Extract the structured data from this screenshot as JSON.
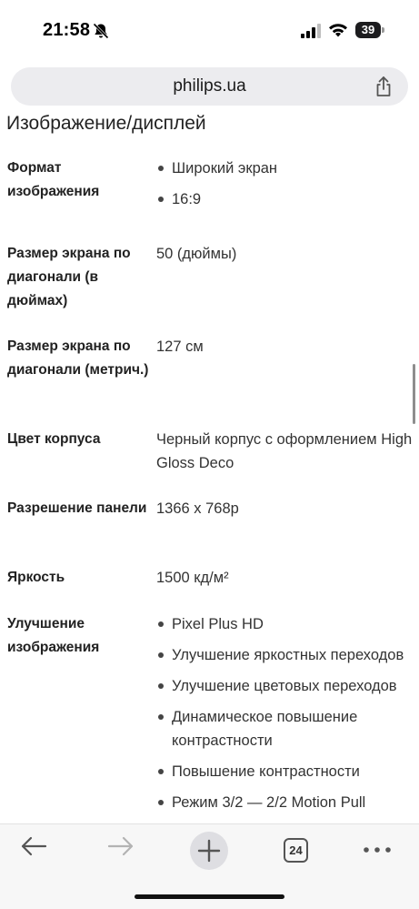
{
  "status_bar": {
    "time": "21:58",
    "battery_level": "39"
  },
  "browser": {
    "url": "philips.ua",
    "tab_count": "24"
  },
  "section": {
    "title": "Изображение/дисплей"
  },
  "specs": {
    "format": {
      "label": "Формат изображения",
      "items": [
        "Широкий экран",
        "16:9"
      ]
    },
    "size_inch": {
      "label": "Размер экрана по диагонали (в дюймах)",
      "value": "50  (дюймы)"
    },
    "size_metric": {
      "label": "Размер экрана по диагонали (метрич.)",
      "value": "127  см"
    },
    "color": {
      "label": "Цвет корпуса",
      "value": "Черный корпус с оформлением High Gloss Deco"
    },
    "resolution": {
      "label": "Разрешение панели",
      "value": "1366 x 768p"
    },
    "brightness": {
      "label": "Яркость",
      "value": "1500  кд/м²"
    },
    "enhancement": {
      "label": "Улучшение изображения",
      "items": [
        "Pixel Plus HD",
        "Улучшение яркостных переходов",
        "Улучшение цветовых переходов",
        "Динамическое повышение контрастности",
        "Повышение контрастности",
        "Режим 3/2 — 2/2 Motion Pull"
      ]
    }
  }
}
